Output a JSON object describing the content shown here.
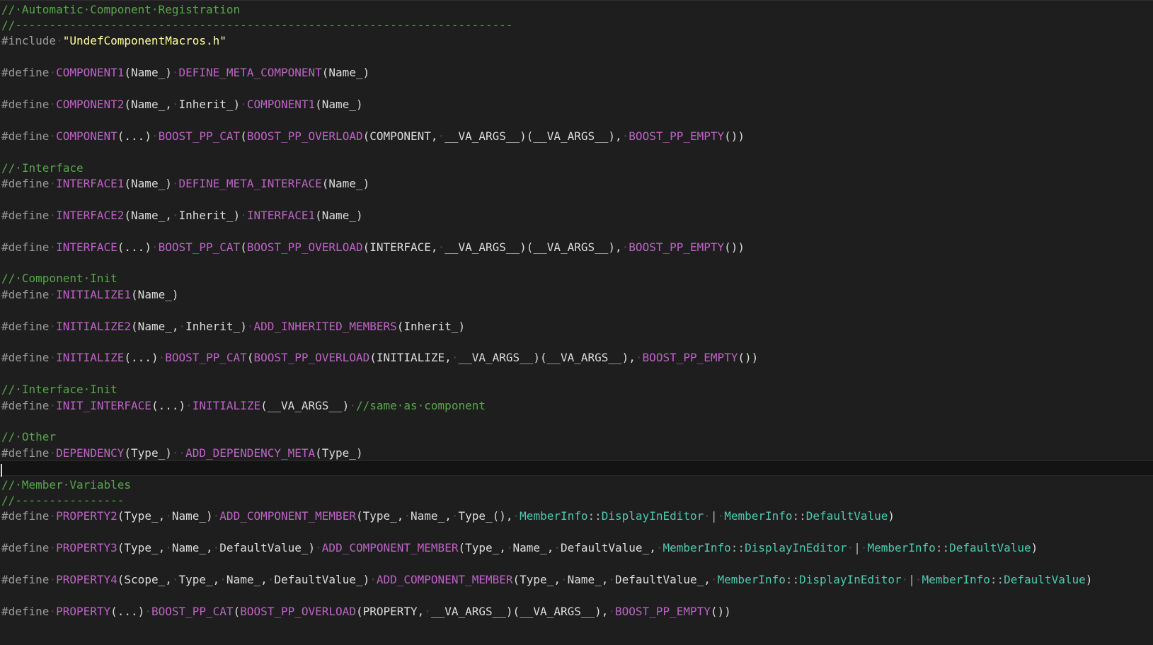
{
  "editor": {
    "language": "C++",
    "colors": {
      "background": "#1e1e1e",
      "comment": "#57a64a",
      "directive": "#9b9b9b",
      "macro": "#bd63c5",
      "string": "#ffff9c",
      "type": "#4ec9b0",
      "plain": "#dcdcdc",
      "whitespace_marker": "#4a4a4a"
    },
    "caret_line_index": 29,
    "lines": [
      [
        [
          "c",
          "//·Automatic·Component·Registration"
        ]
      ],
      [
        [
          "c",
          "//-------------------------------------------------------------------------"
        ]
      ],
      [
        [
          "d",
          "#include"
        ],
        [
          "w",
          "·"
        ],
        [
          "s",
          "\"UndefComponentMacros.h\""
        ]
      ],
      [],
      [
        [
          "d",
          "#define"
        ],
        [
          "w",
          "·"
        ],
        [
          "m",
          "COMPONENT1"
        ],
        [
          "p",
          "(Name_)"
        ],
        [
          "w",
          "·"
        ],
        [
          "m",
          "DEFINE_META_COMPONENT"
        ],
        [
          "p",
          "(Name_)"
        ]
      ],
      [],
      [
        [
          "d",
          "#define"
        ],
        [
          "w",
          "·"
        ],
        [
          "m",
          "COMPONENT2"
        ],
        [
          "p",
          "(Name_,"
        ],
        [
          "w",
          "·"
        ],
        [
          "p",
          "Inherit_)"
        ],
        [
          "w",
          "·"
        ],
        [
          "m",
          "COMPONENT1"
        ],
        [
          "p",
          "(Name_)"
        ]
      ],
      [],
      [
        [
          "d",
          "#define"
        ],
        [
          "w",
          "·"
        ],
        [
          "m",
          "COMPONENT"
        ],
        [
          "p",
          "(...)"
        ],
        [
          "w",
          "·"
        ],
        [
          "m",
          "BOOST_PP_CAT"
        ],
        [
          "p",
          "("
        ],
        [
          "m",
          "BOOST_PP_OVERLOAD"
        ],
        [
          "p",
          "(COMPONENT,"
        ],
        [
          "w",
          "·"
        ],
        [
          "p",
          "__VA_ARGS__)(__VA_ARGS__),"
        ],
        [
          "w",
          "·"
        ],
        [
          "m",
          "BOOST_PP_EMPTY"
        ],
        [
          "p",
          "())"
        ]
      ],
      [],
      [
        [
          "c",
          "//·Interface"
        ]
      ],
      [
        [
          "d",
          "#define"
        ],
        [
          "w",
          "·"
        ],
        [
          "m",
          "INTERFACE1"
        ],
        [
          "p",
          "(Name_)"
        ],
        [
          "w",
          "·"
        ],
        [
          "m",
          "DEFINE_META_INTERFACE"
        ],
        [
          "p",
          "(Name_)"
        ]
      ],
      [],
      [
        [
          "d",
          "#define"
        ],
        [
          "w",
          "·"
        ],
        [
          "m",
          "INTERFACE2"
        ],
        [
          "p",
          "(Name_,"
        ],
        [
          "w",
          "·"
        ],
        [
          "p",
          "Inherit_)"
        ],
        [
          "w",
          "·"
        ],
        [
          "m",
          "INTERFACE1"
        ],
        [
          "p",
          "(Name_)"
        ]
      ],
      [],
      [
        [
          "d",
          "#define"
        ],
        [
          "w",
          "·"
        ],
        [
          "m",
          "INTERFACE"
        ],
        [
          "p",
          "(...)"
        ],
        [
          "w",
          "·"
        ],
        [
          "m",
          "BOOST_PP_CAT"
        ],
        [
          "p",
          "("
        ],
        [
          "m",
          "BOOST_PP_OVERLOAD"
        ],
        [
          "p",
          "(INTERFACE,"
        ],
        [
          "w",
          "·"
        ],
        [
          "p",
          "__VA_ARGS__)(__VA_ARGS__),"
        ],
        [
          "w",
          "·"
        ],
        [
          "m",
          "BOOST_PP_EMPTY"
        ],
        [
          "p",
          "())"
        ]
      ],
      [],
      [
        [
          "c",
          "//·Component·Init"
        ]
      ],
      [
        [
          "d",
          "#define"
        ],
        [
          "w",
          "·"
        ],
        [
          "m",
          "INITIALIZE1"
        ],
        [
          "p",
          "(Name_)"
        ]
      ],
      [],
      [
        [
          "d",
          "#define"
        ],
        [
          "w",
          "·"
        ],
        [
          "m",
          "INITIALIZE2"
        ],
        [
          "p",
          "(Name_,"
        ],
        [
          "w",
          "·"
        ],
        [
          "p",
          "Inherit_)"
        ],
        [
          "w",
          "·"
        ],
        [
          "m",
          "ADD_INHERITED_MEMBERS"
        ],
        [
          "p",
          "(Inherit_)"
        ]
      ],
      [],
      [
        [
          "d",
          "#define"
        ],
        [
          "w",
          "·"
        ],
        [
          "m",
          "INITIALIZE"
        ],
        [
          "p",
          "(...)"
        ],
        [
          "w",
          "·"
        ],
        [
          "m",
          "BOOST_PP_CAT"
        ],
        [
          "p",
          "("
        ],
        [
          "m",
          "BOOST_PP_OVERLOAD"
        ],
        [
          "p",
          "(INITIALIZE,"
        ],
        [
          "w",
          "·"
        ],
        [
          "p",
          "__VA_ARGS__)(__VA_ARGS__),"
        ],
        [
          "w",
          "·"
        ],
        [
          "m",
          "BOOST_PP_EMPTY"
        ],
        [
          "p",
          "())"
        ]
      ],
      [],
      [
        [
          "c",
          "//·Interface·Init"
        ]
      ],
      [
        [
          "d",
          "#define"
        ],
        [
          "w",
          "·"
        ],
        [
          "m",
          "INIT_INTERFACE"
        ],
        [
          "p",
          "(...)"
        ],
        [
          "w",
          "·"
        ],
        [
          "m",
          "INITIALIZE"
        ],
        [
          "p",
          "(__VA_ARGS__)"
        ],
        [
          "w",
          "·"
        ],
        [
          "c",
          "//same·as·component"
        ]
      ],
      [],
      [
        [
          "c",
          "//·Other"
        ]
      ],
      [
        [
          "d",
          "#define"
        ],
        [
          "w",
          "·"
        ],
        [
          "m",
          "DEPENDENCY"
        ],
        [
          "p",
          "(Type_)"
        ],
        [
          "w",
          "··"
        ],
        [
          "m",
          "ADD_DEPENDENCY_META"
        ],
        [
          "p",
          "(Type_)"
        ]
      ],
      [],
      [
        [
          "c",
          "//·Member·Variables"
        ]
      ],
      [
        [
          "c",
          "//----------------"
        ]
      ],
      [
        [
          "d",
          "#define"
        ],
        [
          "w",
          "·"
        ],
        [
          "m",
          "PROPERTY2"
        ],
        [
          "p",
          "(Type_,"
        ],
        [
          "w",
          "·"
        ],
        [
          "p",
          "Name_)"
        ],
        [
          "w",
          "·"
        ],
        [
          "m",
          "ADD_COMPONENT_MEMBER"
        ],
        [
          "p",
          "(Type_,"
        ],
        [
          "w",
          "·"
        ],
        [
          "p",
          "Name_,"
        ],
        [
          "w",
          "·"
        ],
        [
          "p",
          "Type_(),"
        ],
        [
          "w",
          "·"
        ],
        [
          "t",
          "MemberInfo"
        ],
        [
          "o",
          "::"
        ],
        [
          "t",
          "DisplayInEditor"
        ],
        [
          "w",
          "·"
        ],
        [
          "o",
          "|"
        ],
        [
          "w",
          "·"
        ],
        [
          "t",
          "MemberInfo"
        ],
        [
          "o",
          "::"
        ],
        [
          "t",
          "DefaultValue"
        ],
        [
          "p",
          ")"
        ]
      ],
      [],
      [
        [
          "d",
          "#define"
        ],
        [
          "w",
          "·"
        ],
        [
          "m",
          "PROPERTY3"
        ],
        [
          "p",
          "(Type_,"
        ],
        [
          "w",
          "·"
        ],
        [
          "p",
          "Name_,"
        ],
        [
          "w",
          "·"
        ],
        [
          "p",
          "DefaultValue_)"
        ],
        [
          "w",
          "·"
        ],
        [
          "m",
          "ADD_COMPONENT_MEMBER"
        ],
        [
          "p",
          "(Type_,"
        ],
        [
          "w",
          "·"
        ],
        [
          "p",
          "Name_,"
        ],
        [
          "w",
          "·"
        ],
        [
          "p",
          "DefaultValue_,"
        ],
        [
          "w",
          "·"
        ],
        [
          "t",
          "MemberInfo"
        ],
        [
          "o",
          "::"
        ],
        [
          "t",
          "DisplayInEditor"
        ],
        [
          "w",
          "·"
        ],
        [
          "o",
          "|"
        ],
        [
          "w",
          "·"
        ],
        [
          "t",
          "MemberInfo"
        ],
        [
          "o",
          "::"
        ],
        [
          "t",
          "DefaultValue"
        ],
        [
          "p",
          ")"
        ]
      ],
      [],
      [
        [
          "d",
          "#define"
        ],
        [
          "w",
          "·"
        ],
        [
          "m",
          "PROPERTY4"
        ],
        [
          "p",
          "(Scope_,"
        ],
        [
          "w",
          "·"
        ],
        [
          "p",
          "Type_,"
        ],
        [
          "w",
          "·"
        ],
        [
          "p",
          "Name_,"
        ],
        [
          "w",
          "·"
        ],
        [
          "p",
          "DefaultValue_)"
        ],
        [
          "w",
          "·"
        ],
        [
          "m",
          "ADD_COMPONENT_MEMBER"
        ],
        [
          "p",
          "(Type_,"
        ],
        [
          "w",
          "·"
        ],
        [
          "p",
          "Name_,"
        ],
        [
          "w",
          "·"
        ],
        [
          "p",
          "DefaultValue_,"
        ],
        [
          "w",
          "·"
        ],
        [
          "t",
          "MemberInfo"
        ],
        [
          "o",
          "::"
        ],
        [
          "t",
          "DisplayInEditor"
        ],
        [
          "w",
          "·"
        ],
        [
          "o",
          "|"
        ],
        [
          "w",
          "·"
        ],
        [
          "t",
          "MemberInfo"
        ],
        [
          "o",
          "::"
        ],
        [
          "t",
          "DefaultValue"
        ],
        [
          "p",
          ")"
        ]
      ],
      [],
      [
        [
          "d",
          "#define"
        ],
        [
          "w",
          "·"
        ],
        [
          "m",
          "PROPERTY"
        ],
        [
          "p",
          "(...)"
        ],
        [
          "w",
          "·"
        ],
        [
          "m",
          "BOOST_PP_CAT"
        ],
        [
          "p",
          "("
        ],
        [
          "m",
          "BOOST_PP_OVERLOAD"
        ],
        [
          "p",
          "(PROPERTY,"
        ],
        [
          "w",
          "·"
        ],
        [
          "p",
          "__VA_ARGS__)(__VA_ARGS__),"
        ],
        [
          "w",
          "·"
        ],
        [
          "m",
          "BOOST_PP_EMPTY"
        ],
        [
          "p",
          "())"
        ]
      ]
    ]
  }
}
